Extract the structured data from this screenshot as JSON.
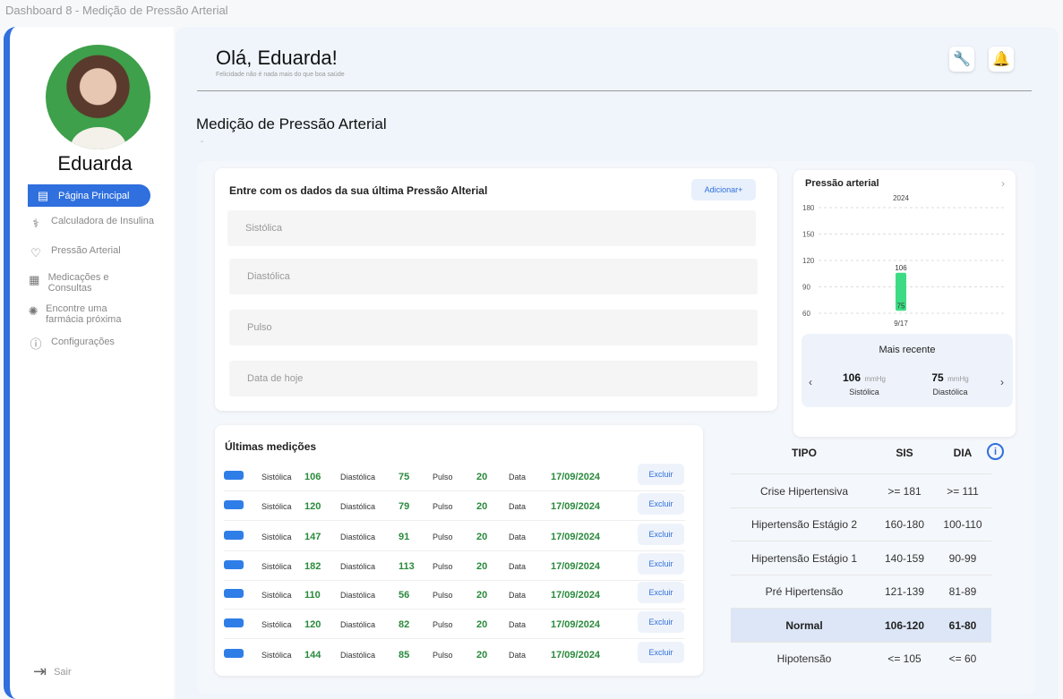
{
  "window": {
    "title": "Dashboard 8 - Medição de Pressão Arterial"
  },
  "sidebar": {
    "user_name": "Eduarda",
    "items": [
      {
        "label": "Página Principal",
        "icon": "clipboard-icon",
        "active": true
      },
      {
        "label": "Calculadora de Insulina",
        "icon": "stethoscope-icon"
      },
      {
        "label": "Pressão Arterial",
        "icon": "heart-pulse-icon"
      },
      {
        "label": "Medicações e Consultas",
        "icon": "calendar-icon"
      },
      {
        "label": "Encontre uma farmácia próxima",
        "icon": "virus-icon"
      },
      {
        "label": "Configurações",
        "icon": "info-icon"
      }
    ],
    "logout": "Sair"
  },
  "header": {
    "greeting": "Olá, Eduarda!",
    "subtitle": "Felicidade não é nada mais do que boa saúde"
  },
  "page": {
    "title": "Medição de Pressão Arterial",
    "mark": "-"
  },
  "form": {
    "title": "Entre com os dados da sua última Pressão Alterial",
    "add_button": "Adicionar+",
    "fields": [
      "Sistólica",
      "Diastólica",
      "Pulso",
      "Data de hoje"
    ]
  },
  "chart_data": {
    "type": "bar",
    "title": "Pressão arterial",
    "year_label": "2024",
    "categories": [
      "9/17"
    ],
    "series": [
      {
        "values": [
          106
        ]
      },
      {
        "values": [
          75
        ]
      }
    ],
    "yticks": [
      60,
      90,
      120,
      150,
      180
    ],
    "ylim": [
      60,
      180
    ],
    "colors": {
      "bar": "#3ddc84"
    }
  },
  "recent": {
    "title": "Mais recente",
    "systolic": "106",
    "diastolic": "75",
    "unit": "mmHg",
    "systolic_label": "Sistólica",
    "diastolic_label": "Diastólica"
  },
  "measurements": {
    "title": "Últimas medições",
    "labels": {
      "sys": "Sistólica",
      "dia": "Diastólica",
      "pulse": "Pulso",
      "date": "Data",
      "delete": "Excluir"
    },
    "rows": [
      {
        "sys": "106",
        "dia": "75",
        "pulse": "20",
        "date": "17/09/2024"
      },
      {
        "sys": "120",
        "dia": "79",
        "pulse": "20",
        "date": "17/09/2024"
      },
      {
        "sys": "147",
        "dia": "91",
        "pulse": "20",
        "date": "17/09/2024"
      },
      {
        "sys": "182",
        "dia": "113",
        "pulse": "20",
        "date": "17/09/2024"
      },
      {
        "sys": "110",
        "dia": "56",
        "pulse": "20",
        "date": "17/09/2024"
      },
      {
        "sys": "120",
        "dia": "82",
        "pulse": "20",
        "date": "17/09/2024"
      },
      {
        "sys": "144",
        "dia": "85",
        "pulse": "20",
        "date": "17/09/2024"
      }
    ]
  },
  "classification": {
    "headers": {
      "type": "TIPO",
      "sis": "SIS",
      "dia": "DIA"
    },
    "rows": [
      {
        "type": "Crise Hipertensiva",
        "sis": ">= 181",
        "dia": ">= 111"
      },
      {
        "type": "Hipertensão Estágio 2",
        "sis": "160-180",
        "dia": "100-110"
      },
      {
        "type": "Hipertensão Estágio 1",
        "sis": "140-159",
        "dia": "90-99"
      },
      {
        "type": "Pré Hipertensão",
        "sis": "121-139",
        "dia": "81-89"
      },
      {
        "type": "Normal",
        "sis": "106-120",
        "dia": "61-80",
        "highlight": true
      },
      {
        "type": "Hipotensão",
        "sis": "<= 105",
        "dia": "<= 60"
      }
    ]
  }
}
